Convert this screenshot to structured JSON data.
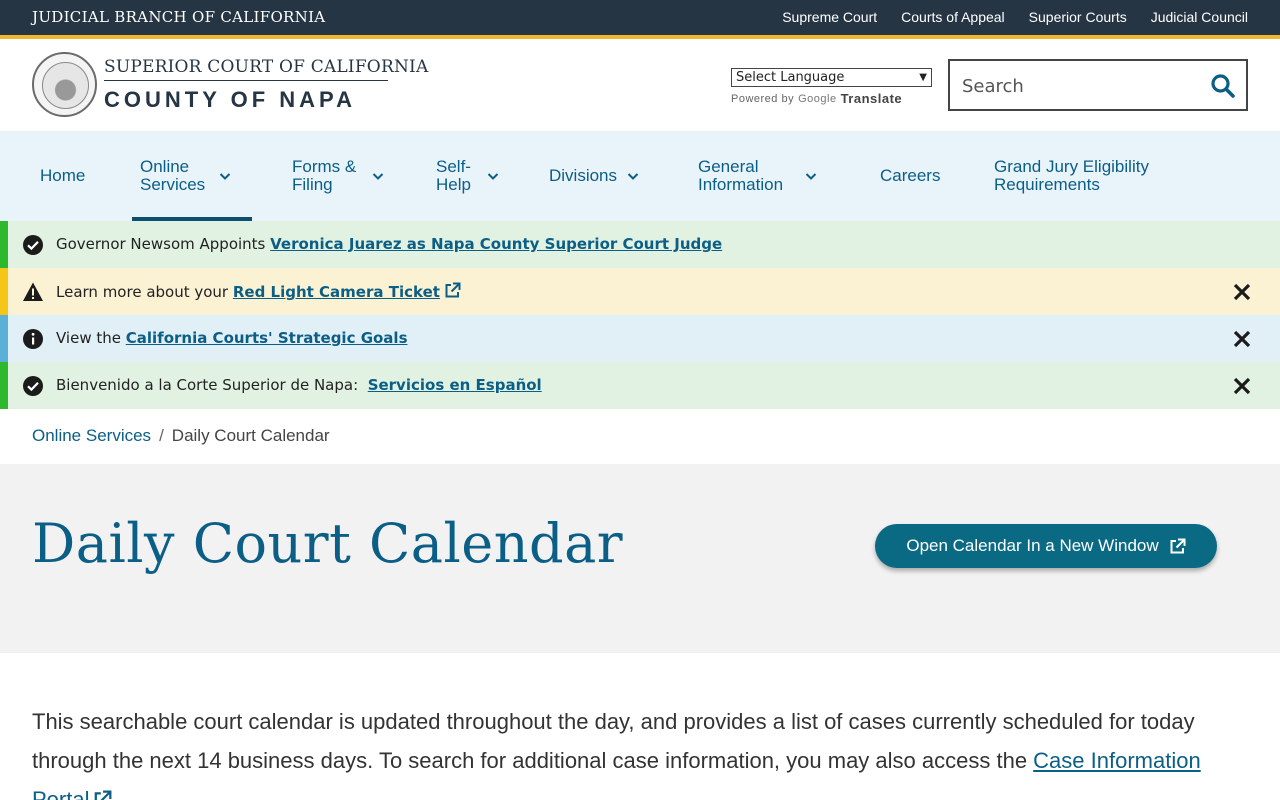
{
  "topbar": {
    "branch": "JUDICIAL BRANCH OF CALIFORNIA",
    "links": [
      "Supreme Court",
      "Courts of Appeal",
      "Superior Courts",
      "Judicial Council"
    ]
  },
  "header": {
    "logo_line1": "SUPERIOR COURT OF CALIFORNIA",
    "logo_line2": "COUNTY OF NAPA",
    "language_select": "Select Language",
    "powered_by": "Powered by",
    "google": "Google",
    "translate": "Translate",
    "search_placeholder": "Search"
  },
  "nav": {
    "items": [
      {
        "label": "Home"
      },
      {
        "label": "Online\nServices"
      },
      {
        "label": "Forms &\nFiling"
      },
      {
        "label": "Self-\nHelp"
      },
      {
        "label": "Divisions"
      },
      {
        "label": "General\nInformation"
      },
      {
        "label": "Careers"
      },
      {
        "label": "Grand Jury Eligibility\nRequirements"
      }
    ]
  },
  "alerts": [
    {
      "prefix": "Governor Newsom Appoints ",
      "link": "Veronica Juarez as Napa County Superior Court Judge"
    },
    {
      "prefix": "Learn more about your ",
      "link": "Red Light Camera Ticket"
    },
    {
      "prefix": "View the ",
      "link": "California Courts' Strategic Goals"
    },
    {
      "prefix": "Bienvenido a la Corte Superior de Napa:  ",
      "link": "Servicios en Español"
    }
  ],
  "breadcrumb": {
    "parent": "Online Services",
    "separator": "/",
    "current": "Daily Court Calendar"
  },
  "hero": {
    "title": "Daily Court Calendar",
    "button": "Open Calendar In a New Window"
  },
  "intro": {
    "text": "This searchable court calendar is updated throughout the day, and provides a list of cases currently scheduled for today through the next 14 business days. To search for additional case information, you may also access the ",
    "link": "Case Information Portal"
  },
  "colors": {
    "topbar": "#263543",
    "accent_gold": "#f2b531",
    "link_blue": "#0b5e86",
    "nav_bg": "#e9f3fa",
    "alert_success_bg": "#e2f2e2",
    "alert_success_bar": "#2eb82e",
    "alert_warning_bg": "#fbf2d4",
    "alert_warning_bar": "#f5c518",
    "alert_info_bg": "#e1eff6",
    "alert_info_bar": "#5ab0d6",
    "button_teal": "#0b6a83"
  },
  "icons": {
    "search": "search-icon",
    "nav_chevron": "chevron-down-icon",
    "alert_success": "check-circle-icon",
    "alert_warning": "warning-triangle-icon",
    "alert_info": "info-circle-icon",
    "close": "close-icon",
    "external": "external-link-icon"
  }
}
